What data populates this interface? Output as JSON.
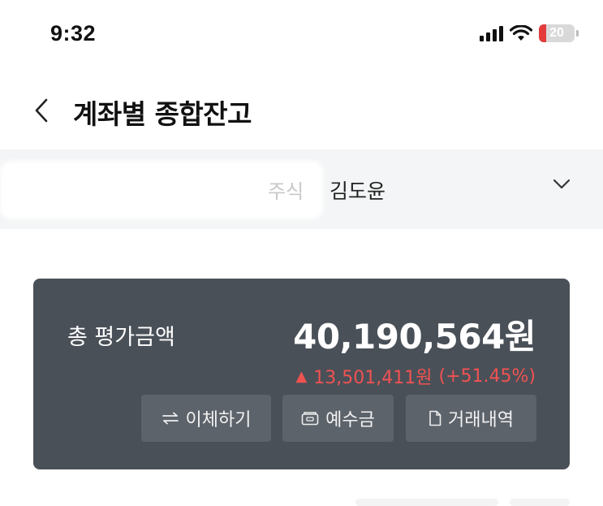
{
  "status_bar": {
    "time": "9:32",
    "battery_level": "20",
    "battery_color": "#e33b3b",
    "icons": [
      "signal-icon",
      "wifi-icon",
      "battery-icon"
    ]
  },
  "header": {
    "title": "계좌별 종합잔고",
    "back_icon": "chevron-left-icon"
  },
  "account": {
    "type": "주식",
    "owner": "김도윤",
    "dropdown_icon": "chevron-down-icon"
  },
  "balance": {
    "label": "총 평가금액",
    "total": "40,190,564원",
    "change_arrow": "▲",
    "change_amount": "13,501,411원",
    "change_percent": "(+51.45%)",
    "change_color": "#f05252"
  },
  "actions": {
    "transfer_label": "이체하기",
    "deposit_label": "예수금",
    "history_label": "거래내역"
  },
  "colors": {
    "card_background": "#4a5058",
    "button_background": "#5d636b",
    "selector_background": "#f4f5f6"
  }
}
